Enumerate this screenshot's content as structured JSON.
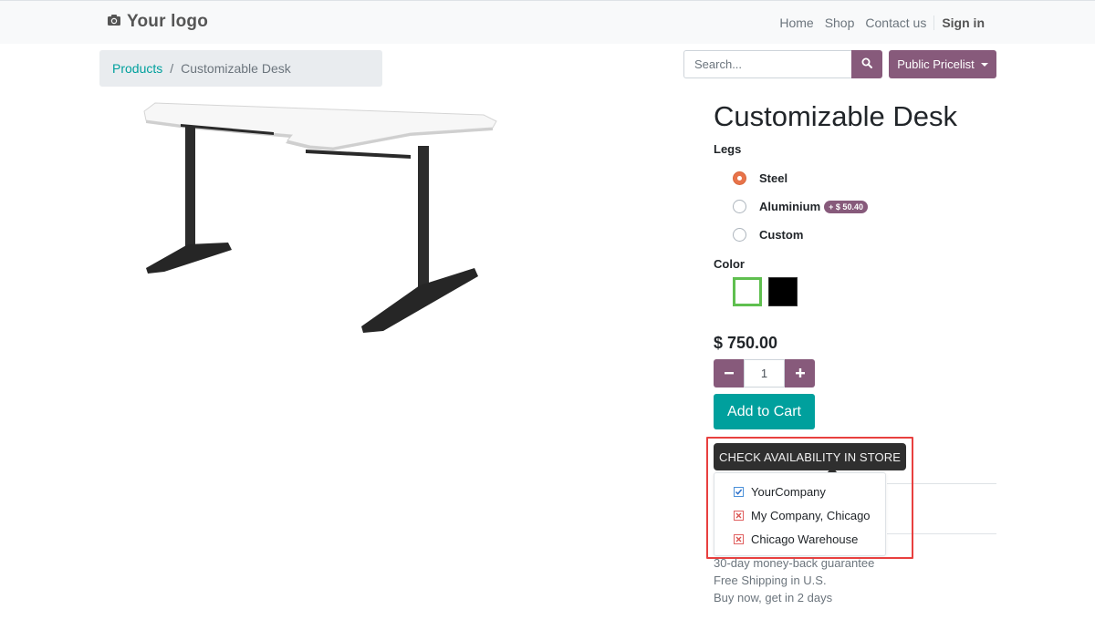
{
  "header": {
    "logo_text": "Your logo",
    "nav": [
      "Home",
      "Shop",
      "Contact us"
    ],
    "signin": "Sign in"
  },
  "breadcrumb": {
    "parent": "Products",
    "separator": "/",
    "current": "Customizable Desk"
  },
  "search": {
    "placeholder": "Search..."
  },
  "pricelist": {
    "label": "Public Pricelist"
  },
  "product": {
    "title": "Customizable Desk",
    "legs": {
      "label": "Legs",
      "options": [
        {
          "name": "Steel",
          "checked": true,
          "extra": ""
        },
        {
          "name": "Aluminium",
          "checked": false,
          "extra": "+ $ 50.40"
        },
        {
          "name": "Custom",
          "checked": false,
          "extra": ""
        }
      ]
    },
    "color": {
      "label": "Color",
      "options": [
        {
          "name": "White",
          "hex": "#ffffff",
          "selected": true
        },
        {
          "name": "Black",
          "hex": "#000000",
          "selected": false
        }
      ]
    },
    "price": "$ 750.00",
    "quantity": "1",
    "add_to_cart": "Add to Cart"
  },
  "availability": {
    "button_label": "CHECK AVAILABILITY IN STORE",
    "stores": [
      {
        "name": "YourCompany",
        "available": true
      },
      {
        "name": "My Company, Chicago",
        "available": false
      },
      {
        "name": "Chicago Warehouse",
        "available": false
      }
    ]
  },
  "features": [
    "30-day money-back guarantee",
    "Free Shipping in U.S.",
    "Buy now, get in 2 days"
  ],
  "colors": {
    "primary": "#875A7B",
    "accent": "#00A09D",
    "highlight": "#e8403f"
  }
}
